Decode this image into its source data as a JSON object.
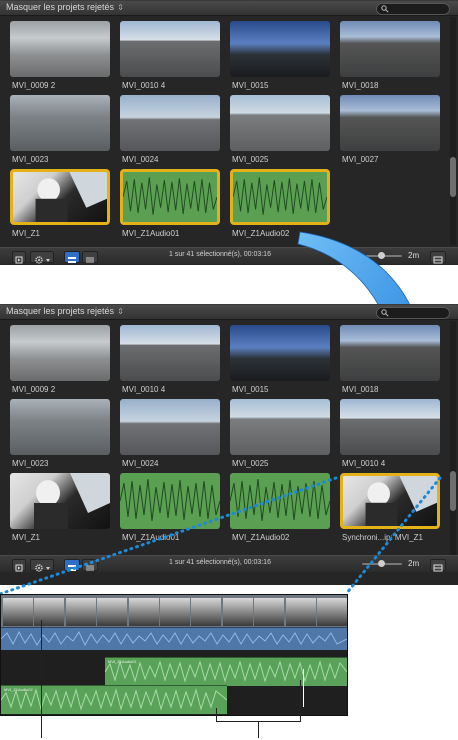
{
  "browser": {
    "filter_label": "Masquer les projets rejetés",
    "filter_chevron": "⇕",
    "status": "1 sur 41 sélectionné(s), 00:03:16",
    "duration": "2m",
    "colors": {
      "selection": "#e3b21b",
      "audio_clip": "#5a9f52",
      "arrow": "#2f8fe0",
      "dotted_guide": "#1e8ad6"
    }
  },
  "top_browser": {
    "clips": [
      {
        "name": "MVI_0009 2",
        "scene": "drift",
        "selected": false
      },
      {
        "name": "MVI_0010 4",
        "scene": "track",
        "selected": false
      },
      {
        "name": "MVI_0015",
        "scene": "dusk",
        "selected": false
      },
      {
        "name": "MVI_0018",
        "scene": "stand",
        "selected": false
      },
      {
        "name": "MVI_0023",
        "scene": "turn",
        "selected": false
      },
      {
        "name": "MVI_0024",
        "scene": "car",
        "selected": false
      },
      {
        "name": "MVI_0025",
        "scene": "road",
        "selected": false
      },
      {
        "name": "MVI_0027",
        "scene": "stand",
        "selected": false
      },
      {
        "name": "MVI_Z1",
        "scene": "cockpit",
        "selected": true
      },
      {
        "name": "MVI_Z1Audio01",
        "scene": "audio",
        "selected": true
      },
      {
        "name": "MVI_Z1Audio02",
        "scene": "audio",
        "selected": true
      }
    ]
  },
  "bottom_browser": {
    "clips": [
      {
        "name": "MVI_0009 2",
        "scene": "drift",
        "selected": false
      },
      {
        "name": "MVI_0010 4",
        "scene": "track",
        "selected": false
      },
      {
        "name": "MVI_0015",
        "scene": "dusk",
        "selected": false
      },
      {
        "name": "MVI_0018",
        "scene": "stand",
        "selected": false
      },
      {
        "name": "MVI_0023",
        "scene": "turn",
        "selected": false
      },
      {
        "name": "MVI_0024",
        "scene": "car",
        "selected": false
      },
      {
        "name": "MVI_0025",
        "scene": "road",
        "selected": false
      },
      {
        "name": "MVI_0010 4",
        "scene": "track",
        "selected": false
      },
      {
        "name": "MVI_Z1",
        "scene": "cockpit",
        "selected": false
      },
      {
        "name": "MVI_Z1Audio01",
        "scene": "audio",
        "selected": false
      },
      {
        "name": "MVI_Z1Audio02",
        "scene": "audio",
        "selected": false
      },
      {
        "name": "Synchroni...ip: MVI_Z1",
        "scene": "cockpit",
        "selected": true
      }
    ]
  },
  "timeline": {
    "clips": [
      {
        "label": "MVI_Z1Audio01"
      },
      {
        "label": "MVI_Z1Audio02"
      }
    ]
  }
}
